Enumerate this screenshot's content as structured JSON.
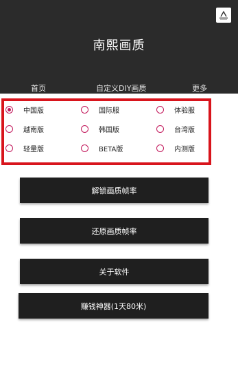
{
  "header": {
    "title": "南熙画质",
    "logo": "app-logo"
  },
  "tabs": [
    {
      "label": "首页"
    },
    {
      "label": "自定义DIY画质"
    },
    {
      "label": "更多"
    }
  ],
  "versions": {
    "selected": "中国版",
    "items": [
      {
        "label": "中国版",
        "checked": true
      },
      {
        "label": "国际服",
        "checked": false
      },
      {
        "label": "体验服",
        "checked": false
      },
      {
        "label": "越南版",
        "checked": false
      },
      {
        "label": "韩国版",
        "checked": false
      },
      {
        "label": "台湾版",
        "checked": false
      },
      {
        "label": "轻量版",
        "checked": false
      },
      {
        "label": "BETA版",
        "checked": false
      },
      {
        "label": "内测版",
        "checked": false
      }
    ]
  },
  "buttons": {
    "unlock": "解锁画质帧率",
    "restore": "还原画质帧率",
    "about": "关于软件",
    "earn": "赚钱神器(1天80米)"
  },
  "colors": {
    "header_bg": "#2b2b2b",
    "highlight_border": "#d8141c",
    "radio": "#c2185b",
    "button_bg": "#1f1f1f"
  }
}
